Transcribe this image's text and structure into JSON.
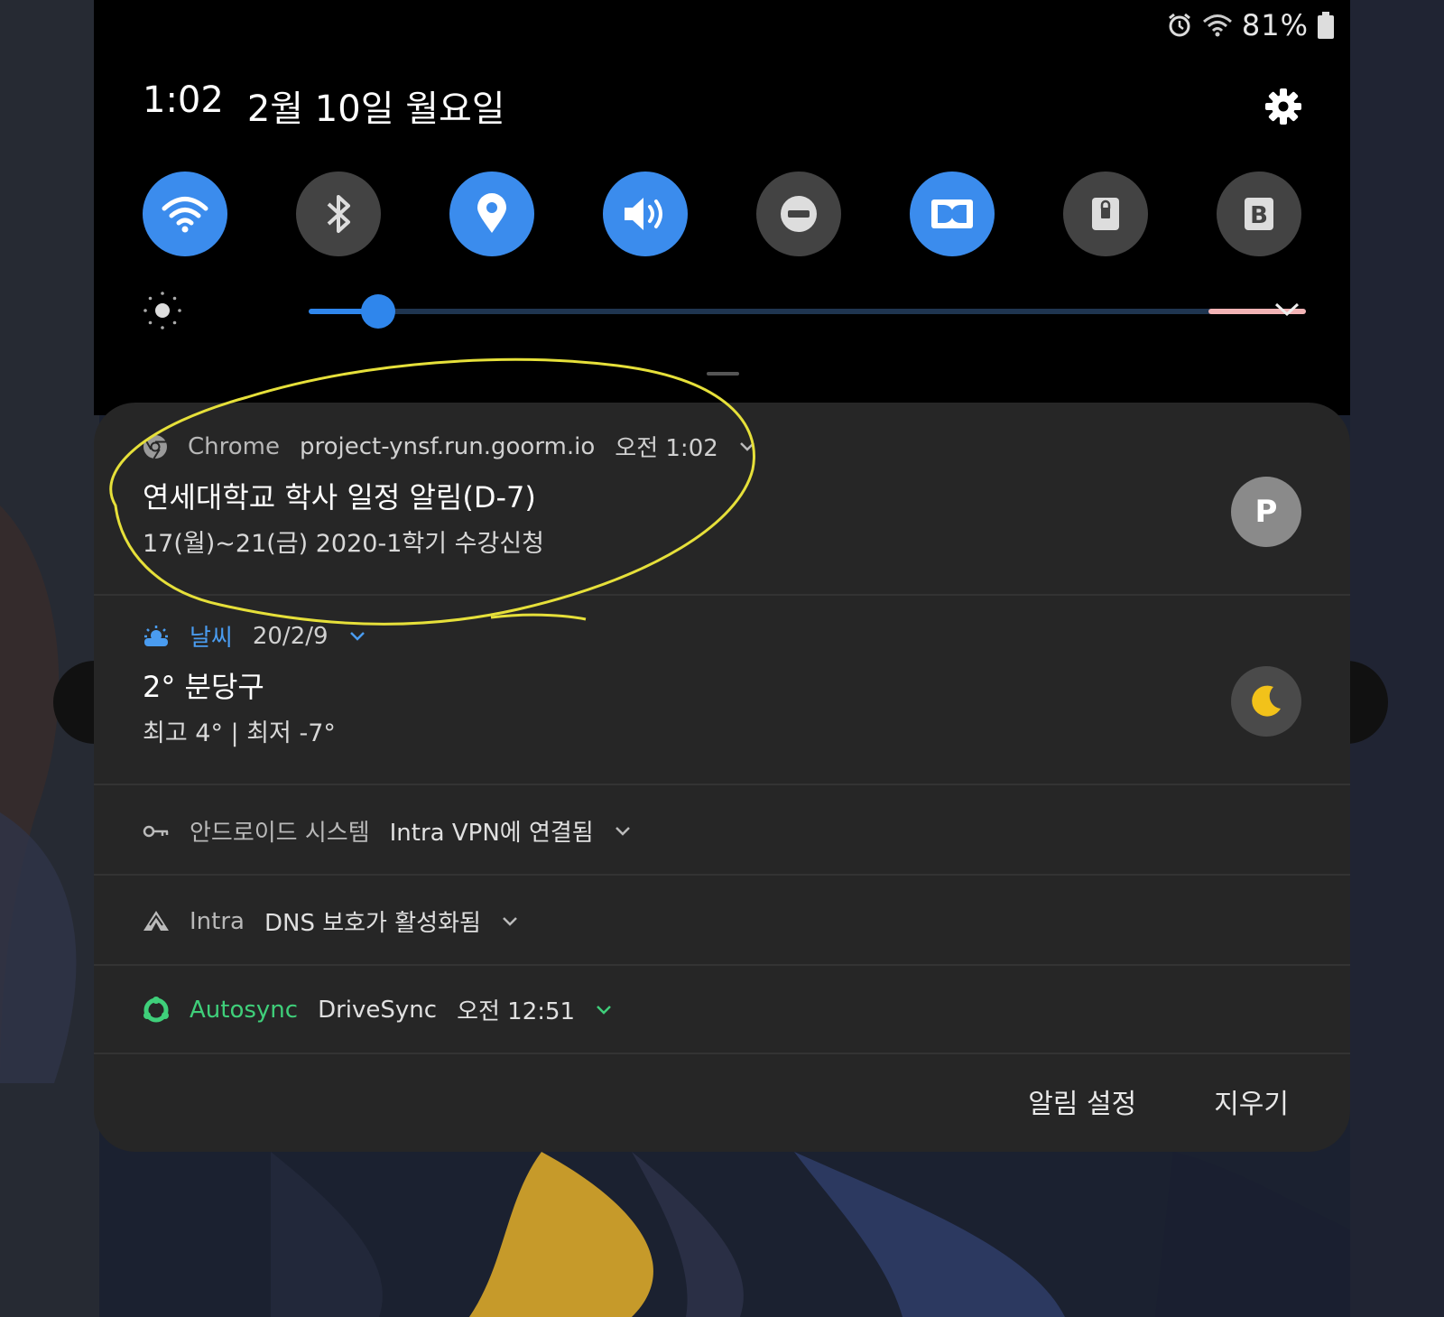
{
  "status_bar": {
    "battery_percent": "81%",
    "icons": [
      "alarm-icon",
      "wifi-icon",
      "battery-icon"
    ]
  },
  "header": {
    "time": "1:02",
    "date": "2월 10일 월요일"
  },
  "quick_settings": [
    {
      "name": "wifi",
      "icon": "wifi-icon",
      "state": "on"
    },
    {
      "name": "bluetooth",
      "icon": "bluetooth-icon",
      "state": "off"
    },
    {
      "name": "location",
      "icon": "location-pin-icon",
      "state": "on"
    },
    {
      "name": "sound",
      "icon": "sound-icon",
      "state": "on"
    },
    {
      "name": "do-not-disturb",
      "icon": "do-not-disturb-icon",
      "state": "off"
    },
    {
      "name": "dolby-atmos",
      "icon": "dolby-icon",
      "state": "on"
    },
    {
      "name": "secure-folder",
      "icon": "lock-icon",
      "state": "off"
    },
    {
      "name": "bixby-routines",
      "icon": "bixby-icon",
      "state": "off"
    }
  ],
  "brightness": {
    "level": 0.07
  },
  "notifications": [
    {
      "app": "Chrome",
      "source": "project-ynsf.run.goorm.io",
      "time": "오전 1:02",
      "title": "연세대학교 학사 일정 알림(D-7)",
      "text": "17(월)~21(금) 2020-1학기 수강신청",
      "avatar_letter": "P",
      "annotated": true
    },
    {
      "app": "날씨",
      "time": "20/2/9",
      "title": "2° 분당구",
      "text": "최고 4° | 최저 -7°",
      "app_color": "#4a9cf0"
    },
    {
      "app": "안드로이드 시스템",
      "title": "Intra VPN에 연결됨"
    },
    {
      "app": "Intra",
      "title": "DNS 보호가 활성화됨"
    },
    {
      "app": "Autosync",
      "title": "DriveSync",
      "time": "오전 12:51",
      "app_color": "#3fcf7a"
    }
  ],
  "actions": {
    "settings_label": "알림 설정",
    "clear_label": "지우기"
  },
  "colors": {
    "accent": "#3b8ced",
    "annotation": "#e6e03a"
  }
}
